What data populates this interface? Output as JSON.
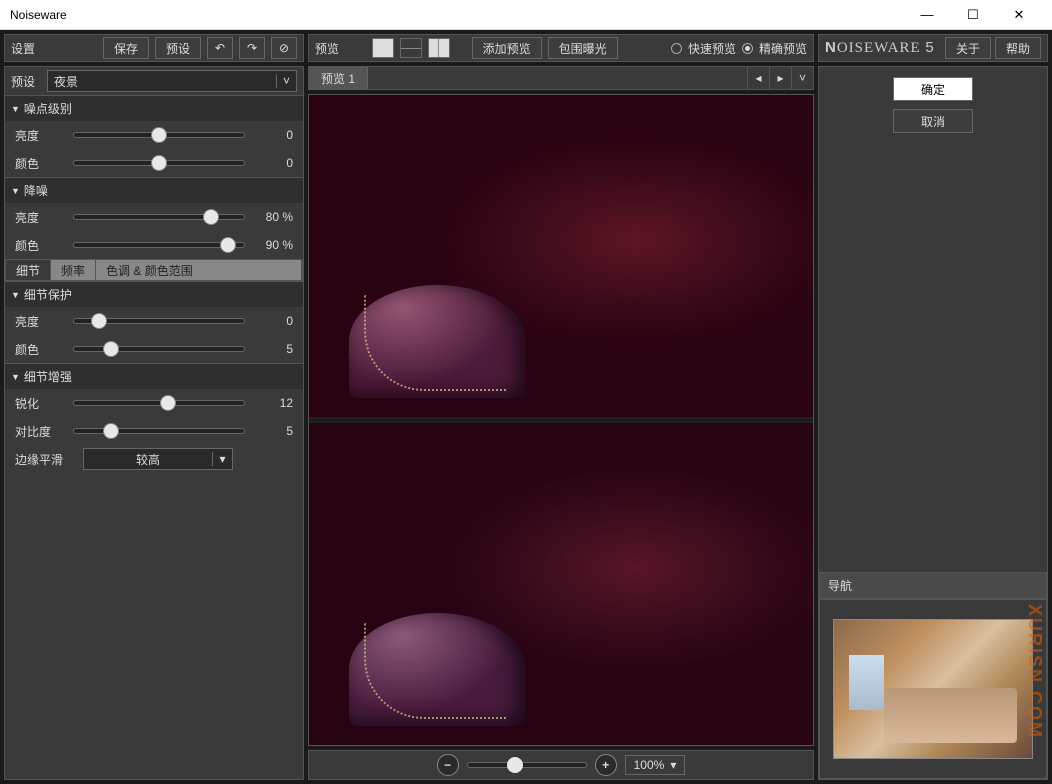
{
  "window": {
    "title": "Noiseware"
  },
  "left": {
    "settings_label": "设置",
    "save_btn": "保存",
    "preset_btn": "预设",
    "preset_label": "预设",
    "preset_value": "夜景",
    "sections": {
      "noise_level": {
        "title": "噪点级别",
        "luminance_label": "亮度",
        "luminance_value": "0",
        "color_label": "颜色",
        "color_value": "0"
      },
      "denoise": {
        "title": "降噪",
        "luminance_label": "亮度",
        "luminance_value": "80 %",
        "color_label": "颜色",
        "color_value": "90 %"
      },
      "tabs": {
        "detail": "细节",
        "frequency": "频率",
        "tonal": "色调 & 颜色范围"
      },
      "detail_protect": {
        "title": "细节保护",
        "luminance_label": "亮度",
        "luminance_value": "0",
        "color_label": "颜色",
        "color_value": "5"
      },
      "detail_enhance": {
        "title": "细节增强",
        "sharpen_label": "锐化",
        "sharpen_value": "12",
        "contrast_label": "对比度",
        "contrast_value": "5",
        "edge_label": "边缘平滑",
        "edge_value": "较高"
      }
    }
  },
  "center": {
    "preview_label": "预览",
    "add_preview": "添加预览",
    "bracket": "包围曝光",
    "fast_preview": "快速预览",
    "accurate_preview": "精确预览",
    "tab1": "预览 1",
    "zoom_value": "100%"
  },
  "right": {
    "brand": "NOISEWARE",
    "brand_ver": "5",
    "about": "关于",
    "help": "帮助",
    "ok": "确定",
    "cancel": "取消",
    "nav_title": "导航",
    "watermark": "XURISN.COM"
  }
}
